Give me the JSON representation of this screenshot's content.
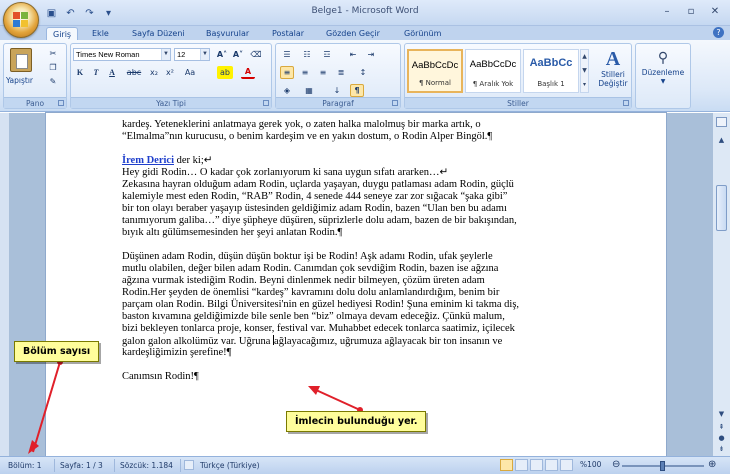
{
  "window": {
    "title": "Belge1 - Microsoft Word",
    "buttons": [
      "–",
      "▫",
      "✕"
    ]
  },
  "quick_access": [
    "save-icon",
    "undo-icon",
    "redo-icon"
  ],
  "tabs": [
    {
      "label": "Giriş",
      "active": true
    },
    {
      "label": "Ekle"
    },
    {
      "label": "Sayfa Düzeni"
    },
    {
      "label": "Başvurular"
    },
    {
      "label": "Postalar"
    },
    {
      "label": "Gözden Geçir"
    },
    {
      "label": "Görünüm"
    }
  ],
  "ribbon": {
    "clipboard": {
      "paste_label": "Yapıştır",
      "group_label": "Pano"
    },
    "font": {
      "name": "Times New Roman",
      "size": "12",
      "group_label": "Yazı Tipi",
      "bold": "K",
      "italic": "T",
      "underline": "A",
      "strike": "abc",
      "sub": "x₂",
      "sup": "x²",
      "case": "Aa"
    },
    "paragraph": {
      "group_label": "Paragraf"
    },
    "styles": {
      "group_label": "Stiller",
      "items": [
        {
          "sample": "AaBbCcDc",
          "name": "¶ Normal"
        },
        {
          "sample": "AaBbCcDc",
          "name": "¶ Aralık Yok"
        },
        {
          "sample": "AaBbCc",
          "name": "Başlık 1"
        }
      ],
      "change_label_1": "Stilleri",
      "change_label_2": "Değiştir"
    },
    "editing": {
      "label": "Düzenleme"
    }
  },
  "document": {
    "lines": [
      "kardeş. Yeteneklerini anlatmaya gerek yok, o zaten halka malolmuş bir marka artık, o",
      "“Elmalma”nın kurucusu, o benim kardeşim ve en yakın dostum, o Rodin Alper Bingöl.¶",
      "",
      "İrem Derici| der ki;↵",
      "Hey gidi Rodin… O kadar çok zorlanıyorum ki sana uygun sıfatı ararken…↵",
      "Zekasına hayran olduğum adam Rodin, uçlarda yaşayan, duygu patlaması adam Rodin, güçlü",
      "kalemiyle mest eden Rodin, “RAB” Rodin, 4 senede 444 seneye zar zor sığacak “şaka gibi”",
      "bir ton olayı beraber yaşayıp üstesinden geldiğimiz adam Rodin, bazen “Ulan ben bu adamı",
      "tanımıyorum galiba…” diye şüpheye düşüren, süprizlerle dolu adam, bazen de bir bakışından,",
      "bıyık altı gülümsemesinden her şeyi anlatan Rodin.¶",
      "",
      "Düşünen adam Rodin, düşün düşün boktur işi be Rodin! Aşk adamı Rodin, ufak şeylerle",
      "mutlu olabilen, değer bilen adam Rodin. Canımdan çok sevdiğim Rodin, bazen ise ağzına",
      "ağzına vurmak istediğim Rodin. Beyni dinlenmek nedir bilmeyen, çözüm üreten adam",
      "Rodin.Her şeyden de önemlisi “kardeş” kavramını dolu dolu anlamlandırdığım, benim bir",
      "parçam olan Rodin. Bilgi Üniversitesi'nin en güzel hediyesi Rodin! Şuna eminim ki takma diş,",
      "baston kıvamına geldiğimizde bile senle ben “biz” olmaya devam edeceğiz. Çünkü malum,",
      "bizi bekleyen tonlarca proje, konser, festival var. Muhabbet edecek tonlarca saatimiz, içilecek",
      "galon galon alkolümüz var. Uğruna ağlayacağımız, uğrumuza ağlayacak bir ton insanın ve",
      "kardeşliğimizin şerefine!¶",
      "",
      "Canımsın Rodin!¶"
    ],
    "author": "İrem Derici",
    "author_rest": " der ki;↵"
  },
  "status": {
    "section": "Bölüm: 1",
    "page": "Sayfa: 1 / 3",
    "words": "Sözcük: 1.184",
    "language": "Türkçe (Türkiye)",
    "zoom": "%100"
  },
  "annotations": {
    "section_callout": "Bölüm sayısı",
    "cursor_callout": "İmlecin bulunduğu yer."
  },
  "colors": {
    "callout_bg": "#fffd9b",
    "arrow": "#e0202a",
    "ribbon": "#dce8f8"
  }
}
